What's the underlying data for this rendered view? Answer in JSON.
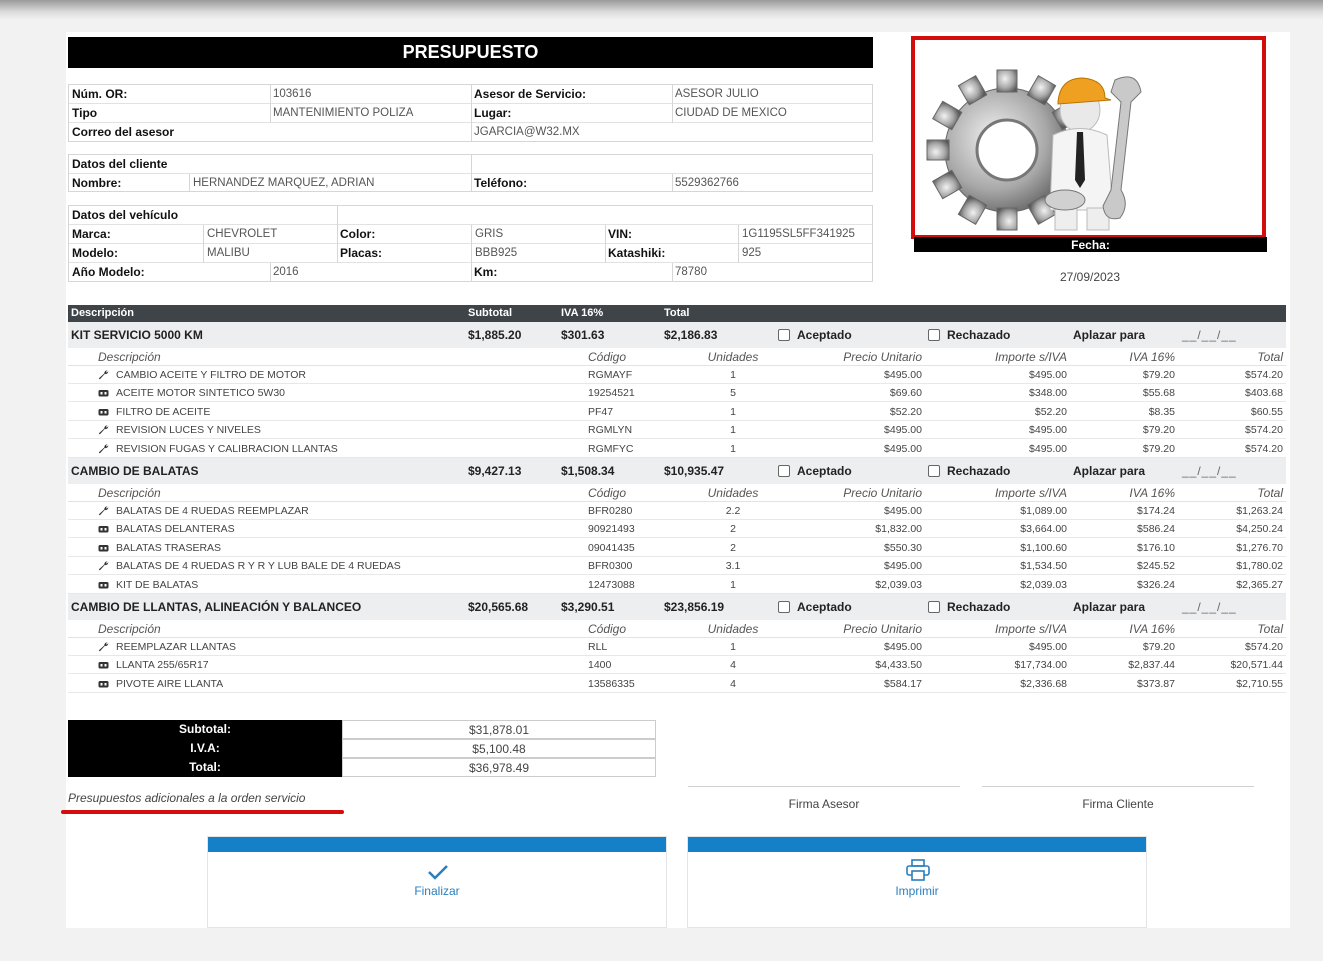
{
  "header": {
    "title": "PRESUPUESTO",
    "num_or_label": "Núm. OR:",
    "num_or": "103616",
    "asesor_label": "Asesor de Servicio:",
    "asesor": "ASESOR JULIO",
    "tipo_label": "Tipo",
    "tipo": "MANTENIMIENTO POLIZA",
    "lugar_label": "Lugar:",
    "lugar": "CIUDAD DE MEXICO",
    "correo_label": "Correo del asesor",
    "correo": "JGARCIA@W32.MX"
  },
  "cliente": {
    "section": "Datos del cliente",
    "nombre_label": "Nombre:",
    "nombre": "HERNANDEZ MARQUEZ, ADRIAN",
    "telefono_label": "Teléfono:",
    "telefono": "5529362766"
  },
  "vehiculo": {
    "section": "Datos del vehículo",
    "marca_label": "Marca:",
    "marca": "CHEVROLET",
    "color_label": "Color:",
    "color": "GRIS",
    "vin_label": "VIN:",
    "vin": "1G1195SL5FF341925",
    "modelo_label": "Modelo:",
    "modelo": "MALIBU",
    "placas_label": "Placas:",
    "placas": "BBB925",
    "katashiki_label": "Katashiki:",
    "katashiki": "925",
    "anio_label": "Año Modelo:",
    "anio": "2016",
    "km_label": "Km:",
    "km": "78780"
  },
  "fecha": {
    "label": "Fecha:",
    "value": "27/09/2023"
  },
  "table": {
    "headers": {
      "descripcion": "Descripción",
      "subtotal": "Subtotal",
      "iva": "IVA 16%",
      "total": "Total"
    },
    "item_headers": {
      "descripcion": "Descripción",
      "codigo": "Código",
      "unidades": "Unidades",
      "precio": "Precio Unitario",
      "importe": "Importe s/IVA",
      "iva": "IVA 16%",
      "total": "Total"
    },
    "aceptado_label": "Aceptado",
    "rechazado_label": "Rechazado",
    "aplazar_label": "Aplazar para",
    "aplazar_placeholder": "__/__/__",
    "groups": [
      {
        "name": "KIT SERVICIO 5000 KM",
        "subtotal": "$1,885.20",
        "iva": "$301.63",
        "total": "$2,186.83",
        "items": [
          {
            "icon": "wrench-icon",
            "desc": "CAMBIO ACEITE Y FILTRO DE MOTOR",
            "codigo": "RGMAYF",
            "unidades": "1",
            "precio": "$495.00",
            "importe": "$495.00",
            "iva": "$79.20",
            "total": "$574.20"
          },
          {
            "icon": "part-icon",
            "desc": "ACEITE MOTOR SINTETICO 5W30",
            "codigo": "19254521",
            "unidades": "5",
            "precio": "$69.60",
            "importe": "$348.00",
            "iva": "$55.68",
            "total": "$403.68"
          },
          {
            "icon": "part-icon",
            "desc": "FILTRO DE ACEITE",
            "codigo": "PF47",
            "unidades": "1",
            "precio": "$52.20",
            "importe": "$52.20",
            "iva": "$8.35",
            "total": "$60.55"
          },
          {
            "icon": "wrench-icon",
            "desc": "REVISION LUCES Y NIVELES",
            "codigo": "RGMLYN",
            "unidades": "1",
            "precio": "$495.00",
            "importe": "$495.00",
            "iva": "$79.20",
            "total": "$574.20"
          },
          {
            "icon": "wrench-icon",
            "desc": "REVISION FUGAS Y CALIBRACION LLANTAS",
            "codigo": "RGMFYC",
            "unidades": "1",
            "precio": "$495.00",
            "importe": "$495.00",
            "iva": "$79.20",
            "total": "$574.20"
          }
        ]
      },
      {
        "name": "CAMBIO DE BALATAS",
        "subtotal": "$9,427.13",
        "iva": "$1,508.34",
        "total": "$10,935.47",
        "items": [
          {
            "icon": "wrench-icon",
            "desc": "BALATAS DE 4 RUEDAS REEMPLAZAR",
            "codigo": "BFR0280",
            "unidades": "2.2",
            "precio": "$495.00",
            "importe": "$1,089.00",
            "iva": "$174.24",
            "total": "$1,263.24"
          },
          {
            "icon": "part-icon",
            "desc": "BALATAS DELANTERAS",
            "codigo": "90921493",
            "unidades": "2",
            "precio": "$1,832.00",
            "importe": "$3,664.00",
            "iva": "$586.24",
            "total": "$4,250.24"
          },
          {
            "icon": "part-icon",
            "desc": "BALATAS TRASERAS",
            "codigo": "09041435",
            "unidades": "2",
            "precio": "$550.30",
            "importe": "$1,100.60",
            "iva": "$176.10",
            "total": "$1,276.70"
          },
          {
            "icon": "wrench-icon",
            "desc": "BALATAS DE 4 RUEDAS R Y R Y LUB BALE DE 4 RUEDAS",
            "codigo": "BFR0300",
            "unidades": "3.1",
            "precio": "$495.00",
            "importe": "$1,534.50",
            "iva": "$245.52",
            "total": "$1,780.02"
          },
          {
            "icon": "part-icon",
            "desc": "KIT DE BALATAS",
            "codigo": "12473088",
            "unidades": "1",
            "precio": "$2,039.03",
            "importe": "$2,039.03",
            "iva": "$326.24",
            "total": "$2,365.27"
          }
        ]
      },
      {
        "name": "CAMBIO DE LLANTAS, ALINEACIÓN Y BALANCEO",
        "subtotal": "$20,565.68",
        "iva": "$3,290.51",
        "total": "$23,856.19",
        "items": [
          {
            "icon": "wrench-icon",
            "desc": "REEMPLAZAR LLANTAS",
            "codigo": "RLL",
            "unidades": "1",
            "precio": "$495.00",
            "importe": "$495.00",
            "iva": "$79.20",
            "total": "$574.20"
          },
          {
            "icon": "part-icon",
            "desc": "LLANTA 255/65R17",
            "codigo": "1400",
            "unidades": "4",
            "precio": "$4,433.50",
            "importe": "$17,734.00",
            "iva": "$2,837.44",
            "total": "$20,571.44"
          },
          {
            "icon": "part-icon",
            "desc": "PIVOTE AIRE LLANTA",
            "codigo": "13586335",
            "unidades": "4",
            "precio": "$584.17",
            "importe": "$2,336.68",
            "iva": "$373.87",
            "total": "$2,710.55"
          }
        ]
      }
    ]
  },
  "totals": {
    "subtotal_label": "Subtotal:",
    "subtotal": "$31,878.01",
    "iva_label": "I.V.A:",
    "iva": "$5,100.48",
    "total_label": "Total:",
    "total": "$36,978.49"
  },
  "note": "Presupuestos adicionales a la orden servicio",
  "firmas": {
    "asesor": "Firma Asesor",
    "cliente": "Firma Cliente"
  },
  "buttons": {
    "finalizar": "Finalizar",
    "imprimir": "Imprimir"
  },
  "colors": {
    "accent": "#1580c7",
    "highlight": "#d30c0c",
    "header_dark": "#3f4449"
  }
}
